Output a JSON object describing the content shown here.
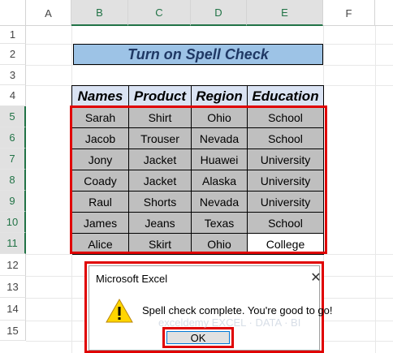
{
  "columns": [
    "A",
    "B",
    "C",
    "D",
    "E",
    "F"
  ],
  "rows": [
    "1",
    "2",
    "3",
    "4",
    "5",
    "6",
    "7",
    "8",
    "9",
    "10",
    "11",
    "12",
    "13",
    "14",
    "15"
  ],
  "title": "Turn on Spell Check",
  "table": {
    "headers": [
      "Names",
      "Product",
      "Region",
      "Education"
    ],
    "rows": [
      [
        "Sarah",
        "Shirt",
        "Ohio",
        "School"
      ],
      [
        "Jacob",
        "Trouser",
        "Nevada",
        "School"
      ],
      [
        "Jony",
        "Jacket",
        "Huawei",
        "University"
      ],
      [
        "Coady",
        "Jacket",
        "Alaska",
        "University"
      ],
      [
        "Raul",
        "Shorts",
        "Nevada",
        "University"
      ],
      [
        "James",
        "Jeans",
        "Texas",
        "School"
      ],
      [
        "Alice",
        "Skirt",
        "Ohio",
        "College"
      ]
    ]
  },
  "dialog": {
    "title": "Microsoft Excel",
    "close": "✕",
    "message": "Spell check complete. You're good to go!",
    "ok_label": "OK"
  },
  "watermark": "exceldemy  EXCEL · DATA · BI",
  "colors": {
    "header_fill": "#dae3f3",
    "cell_fill": "#bfbfbf",
    "title_fill": "#9dc3e6",
    "highlight": "#e00000"
  }
}
